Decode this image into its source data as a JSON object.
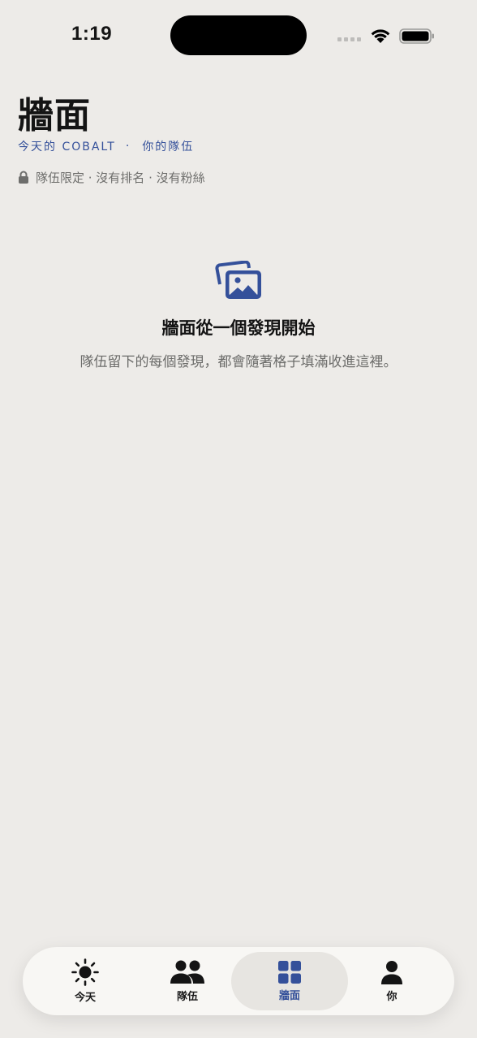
{
  "status_bar": {
    "time": "1:19"
  },
  "header": {
    "title": "牆面",
    "subtitle_left": "今天的 COBALT",
    "subtitle_sep": "·",
    "subtitle_right": "你的隊伍",
    "privacy_note": "隊伍限定 · 沒有排名 · 沒有粉絲"
  },
  "empty_state": {
    "icon": "photos-icon",
    "title": "牆面從一個發現開始",
    "description": "隊伍留下的每個發現，都會隨著格子填滿收進這裡。"
  },
  "tab_bar": {
    "active": "wall",
    "accent_color": "#34509a",
    "tabs": [
      {
        "id": "today",
        "label": "今天",
        "icon": "sun-icon"
      },
      {
        "id": "team",
        "label": "隊伍",
        "icon": "people-icon"
      },
      {
        "id": "wall",
        "label": "牆面",
        "icon": "grid-icon"
      },
      {
        "id": "you",
        "label": "你",
        "icon": "person-icon"
      }
    ]
  }
}
